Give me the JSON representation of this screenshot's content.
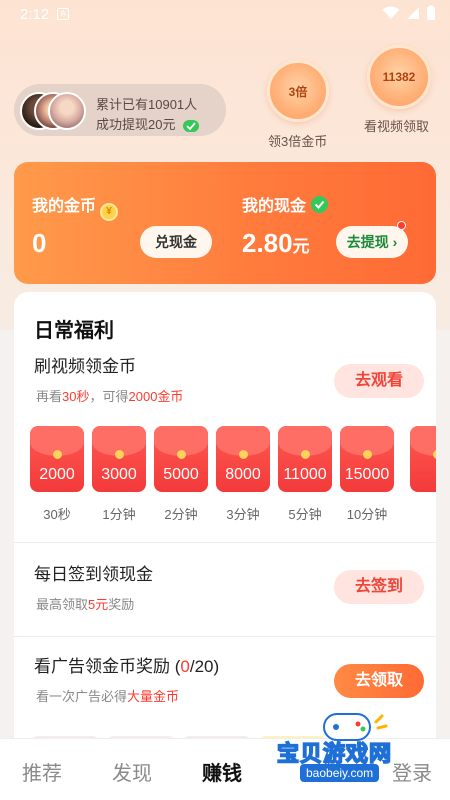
{
  "status": {
    "time": "2:12",
    "notif_letter": "A"
  },
  "withdraw": {
    "line1": "累计已有10901人",
    "line2": "成功提现20元"
  },
  "rewards": [
    {
      "badge": "3倍",
      "label": "领3倍金币"
    },
    {
      "badge": "11382",
      "label": "看视频领取"
    }
  ],
  "wallet": {
    "coins_label": "我的金币",
    "coins_icon_text": "¥",
    "coins_value": "0",
    "exchange_button": "兑现金",
    "cash_label": "我的现金",
    "cash_value": "2.80",
    "cash_unit": "元",
    "withdraw_button": "去提现 ›"
  },
  "daily": {
    "title": "日常福利",
    "tasks": [
      {
        "title": "刷视频领金币",
        "sub_pre": "再看",
        "sub_hl1": "30秒",
        "sub_mid": "，可得",
        "sub_hl2": "2000金币",
        "button": "去观看"
      },
      {
        "title": "每日签到领现金",
        "sub_pre": "最高领取",
        "sub_hl1": "5元",
        "sub_mid": "奖励",
        "button": "去签到"
      },
      {
        "title_pre": "看广告领金币奖励 (",
        "title_hl": "0",
        "title_post": "/20)",
        "sub_pre": "看一次广告必得",
        "sub_hl1": "大量金币",
        "button": "去领取"
      }
    ],
    "envelopes": [
      {
        "amount": "2000",
        "time": "30秒"
      },
      {
        "amount": "3000",
        "time": "1分钟"
      },
      {
        "amount": "5000",
        "time": "2分钟"
      },
      {
        "amount": "8000",
        "time": "3分钟"
      },
      {
        "amount": "11000",
        "time": "5分钟"
      },
      {
        "amount": "15000",
        "time": "10分钟"
      },
      {
        "amount": "",
        "time": ""
      }
    ]
  },
  "nav": {
    "items": [
      "推荐",
      "发现",
      "赚钱",
      "登录"
    ],
    "active": "赚钱"
  },
  "watermark": {
    "text": "宝贝游戏网",
    "url": "baobeiy.com"
  },
  "colors": {
    "accent": "#ff7a3c",
    "highlight": "#ff3b30",
    "success": "#34c759"
  }
}
